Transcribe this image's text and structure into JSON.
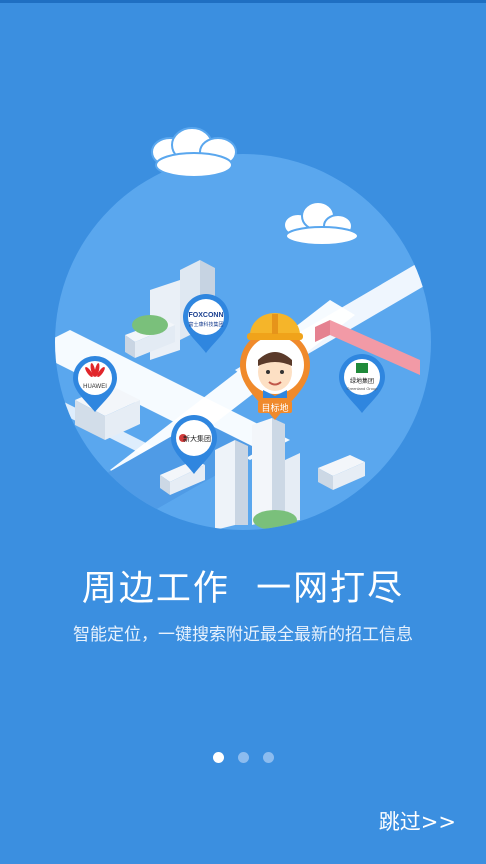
{
  "pins": {
    "foxconn": {
      "title": "FOXCONN",
      "subtitle": "富士康科技集团"
    },
    "huawei": {
      "title": "HUAWEI"
    },
    "xinda": {
      "title": "新大集团"
    },
    "lvdi": {
      "title": "绿地集团",
      "subtitle": "Greenland Group"
    },
    "target": {
      "label": "目标地"
    }
  },
  "headline": "周边工作  一网打尽",
  "subtitle": "智能定位，一键搜索附近最全最新的招工信息",
  "pagination": {
    "count": 3,
    "active_index": 0
  },
  "skip_label": "跳过>>",
  "colors": {
    "background": "#3b8fe0",
    "circle": "#5aa7ee",
    "pin_blue": "#2f86df",
    "pin_orange": "#f08a2b",
    "helmet": "#f5b52a"
  }
}
